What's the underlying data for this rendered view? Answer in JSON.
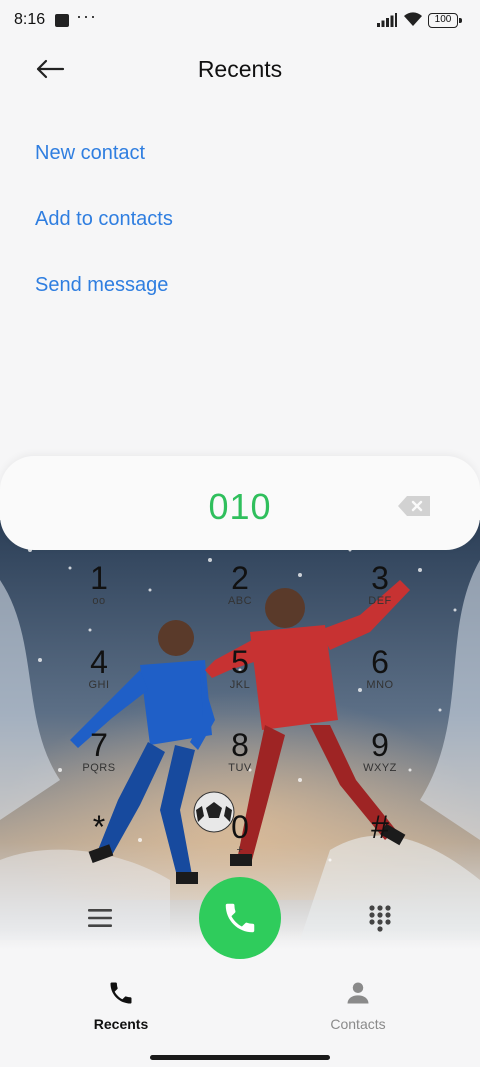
{
  "status_bar": {
    "time": "8:16",
    "more": "···",
    "battery": "100"
  },
  "header": {
    "title": "Recents"
  },
  "actions": {
    "new_contact": "New contact",
    "add_to_contacts": "Add to contacts",
    "send_message": "Send message"
  },
  "dialer": {
    "number": "010",
    "keys": [
      {
        "digit": "1",
        "letters": "oo"
      },
      {
        "digit": "2",
        "letters": "ABC"
      },
      {
        "digit": "3",
        "letters": "DEF"
      },
      {
        "digit": "4",
        "letters": "GHI"
      },
      {
        "digit": "5",
        "letters": "JKL"
      },
      {
        "digit": "6",
        "letters": "MNO"
      },
      {
        "digit": "7",
        "letters": "PQRS"
      },
      {
        "digit": "8",
        "letters": "TUV"
      },
      {
        "digit": "9",
        "letters": "WXYZ"
      },
      {
        "digit": "*",
        "letters": ""
      },
      {
        "digit": "0",
        "letters": "+"
      },
      {
        "digit": "#",
        "letters": ""
      }
    ]
  },
  "bottom_nav": {
    "tabs": [
      {
        "label": "Recents",
        "active": true,
        "icon": "phone-icon"
      },
      {
        "label": "Contacts",
        "active": false,
        "icon": "person-icon"
      }
    ]
  },
  "colors": {
    "accent_blue": "#2f7ee0",
    "call_green": "#2fcc5c",
    "number_green": "#2fbf5c"
  }
}
